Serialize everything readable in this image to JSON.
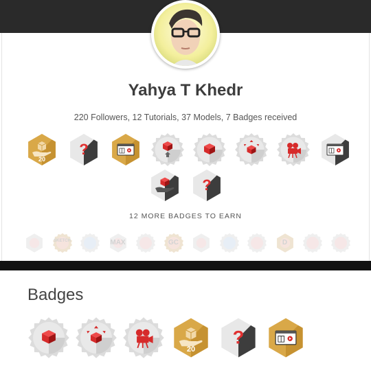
{
  "profile": {
    "name": "Yahya T Khedr",
    "stats": "220 Followers, 12 Tutorials, 37 Models, 7 Badges received"
  },
  "badges_header": {
    "more_label": "12 MORE BADGES TO EARN"
  },
  "badges_received": [
    {
      "name": "badge-hand-box-gold",
      "level": "20",
      "kind": "hand",
      "colors": {
        "primary": "#c8922e"
      }
    },
    {
      "name": "badge-question",
      "kind": "question",
      "colors": {
        "primary": "#e03030"
      }
    },
    {
      "name": "badge-tutorial-gold",
      "kind": "tutorial",
      "colors": {
        "primary": "#c8922e"
      }
    },
    {
      "name": "badge-cube-upload",
      "kind": "cube-arrow-up",
      "colors": {
        "primary": "#d42a2a"
      }
    },
    {
      "name": "badge-cube-gray",
      "kind": "cube",
      "colors": {
        "primary": "#d42a2a"
      }
    },
    {
      "name": "badge-cube-expand",
      "kind": "cube-expand",
      "colors": {
        "primary": "#d42a2a"
      }
    },
    {
      "name": "badge-camera",
      "kind": "camera",
      "colors": {
        "primary": "#d42a2a"
      }
    },
    {
      "name": "badge-tutorial-gray",
      "kind": "tutorial",
      "colors": {
        "primary": "#d42a2a"
      }
    },
    {
      "name": "badge-hand-cube-gray",
      "kind": "hand",
      "colors": {
        "primary": "#d42a2a"
      }
    },
    {
      "name": "badge-question-2",
      "kind": "question",
      "colors": {
        "primary": "#e03030"
      }
    }
  ],
  "badges_to_earn": [
    {
      "name": "ghost-badge-1",
      "text": ""
    },
    {
      "name": "ghost-badge-2",
      "text": "SKETCH"
    },
    {
      "name": "ghost-badge-3",
      "text": ""
    },
    {
      "name": "ghost-badge-4",
      "text": "MAX"
    },
    {
      "name": "ghost-badge-5",
      "text": ""
    },
    {
      "name": "ghost-badge-6",
      "text": "GC"
    },
    {
      "name": "ghost-badge-7",
      "text": ""
    },
    {
      "name": "ghost-badge-8",
      "text": ""
    },
    {
      "name": "ghost-badge-9",
      "text": ""
    },
    {
      "name": "ghost-badge-10",
      "text": "D"
    },
    {
      "name": "ghost-badge-11",
      "text": ""
    },
    {
      "name": "ghost-badge-12",
      "text": ""
    }
  ],
  "badges_section": {
    "title": "Badges"
  },
  "badges_list": [
    {
      "name": "badge-cube-gray",
      "kind": "cube"
    },
    {
      "name": "badge-cube-expand",
      "kind": "cube-expand"
    },
    {
      "name": "badge-camera",
      "kind": "camera"
    },
    {
      "name": "badge-hand-box-gold",
      "level": "20",
      "kind": "hand"
    },
    {
      "name": "badge-question",
      "kind": "question"
    },
    {
      "name": "badge-tutorial-gold",
      "kind": "tutorial"
    }
  ]
}
